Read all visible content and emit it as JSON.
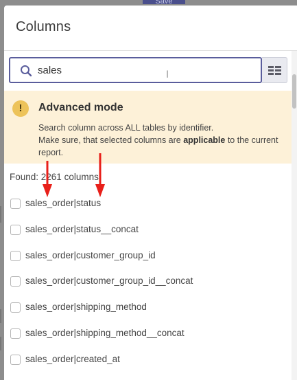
{
  "background": {
    "save_label": "Save"
  },
  "dialog": {
    "title": "Columns"
  },
  "search": {
    "value": "sales",
    "icon": "search-icon"
  },
  "mode_toggle": {
    "icon": "column-list-icon"
  },
  "advanced_mode": {
    "icon": "warning-icon",
    "icon_glyph": "!",
    "title": "Advanced mode",
    "line1": "Search column across ALL tables by identifier.",
    "line2_before": "Make sure, that selected columns are ",
    "line2_bold": "applicable",
    "line2_after": " to the current report."
  },
  "results": {
    "found_text": "Found: 2261 columns",
    "items": [
      {
        "label": "sales_order|status"
      },
      {
        "label": "sales_order|status__concat"
      },
      {
        "label": "sales_order|customer_group_id"
      },
      {
        "label": "sales_order|customer_group_id__concat"
      },
      {
        "label": "sales_order|shipping_method"
      },
      {
        "label": "sales_order|shipping_method__concat"
      },
      {
        "label": "sales_order|created_at"
      }
    ]
  },
  "colors": {
    "accent": "#5a5d9c",
    "warning_bg": "#fdf1d8",
    "warning_icon": "#edc35a",
    "annotation_arrow": "#e8201a"
  }
}
